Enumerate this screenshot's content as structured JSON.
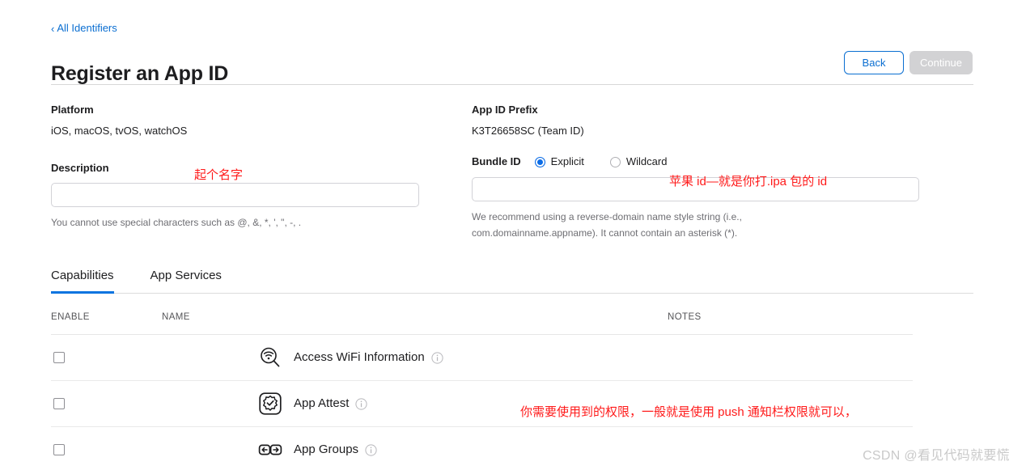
{
  "nav": {
    "back_link": "All Identifiers",
    "back_chevron": "‹"
  },
  "header": {
    "title": "Register an App ID",
    "back_button": "Back",
    "continue_button": "Continue"
  },
  "form": {
    "platform_label": "Platform",
    "platform_value": "iOS, macOS, tvOS, watchOS",
    "description_label": "Description",
    "description_value": "",
    "description_helper": "You cannot use special characters such as @, &, *, ', \", -, .",
    "prefix_label": "App ID Prefix",
    "prefix_value": "K3T26658SC (Team ID)",
    "bundle_label": "Bundle ID",
    "bundle_option_explicit": "Explicit",
    "bundle_option_wildcard": "Wildcard",
    "bundle_selected": "Explicit",
    "bundle_value": "",
    "bundle_helper": "We recommend using a reverse-domain name style string (i.e., com.domainname.appname). It cannot contain an asterisk (*)."
  },
  "tabs": [
    {
      "label": "Capabilities",
      "active": true
    },
    {
      "label": "App Services",
      "active": false
    }
  ],
  "table": {
    "columns": [
      "ENABLE",
      "NAME",
      "NOTES"
    ],
    "rows": [
      {
        "name": "Access WiFi Information",
        "icon": "wifi-magnifier-icon",
        "checked": false,
        "notes": ""
      },
      {
        "name": "App Attest",
        "icon": "app-attest-badge-icon",
        "checked": false,
        "notes": ""
      },
      {
        "name": "App Groups",
        "icon": "app-groups-arrows-icon",
        "checked": false,
        "notes": ""
      }
    ]
  },
  "annotations": [
    {
      "id": "description",
      "text": "起个名字"
    },
    {
      "id": "bundle",
      "text": "苹果 id—就是你打.ipa 包的 id"
    },
    {
      "id": "capabilities",
      "text": "你需要使用到的权限，一般就是使用 push 通知栏权限就可以，"
    }
  ],
  "watermark": "CSDN @看见代码就要慌",
  "colors": {
    "link_blue": "#0a6ed1",
    "accent_blue": "#0b6ce6",
    "tab_underline": "#0a74e0",
    "annotation_red": "#ff1a1a",
    "disabled_gray": "#d2d2d4"
  }
}
